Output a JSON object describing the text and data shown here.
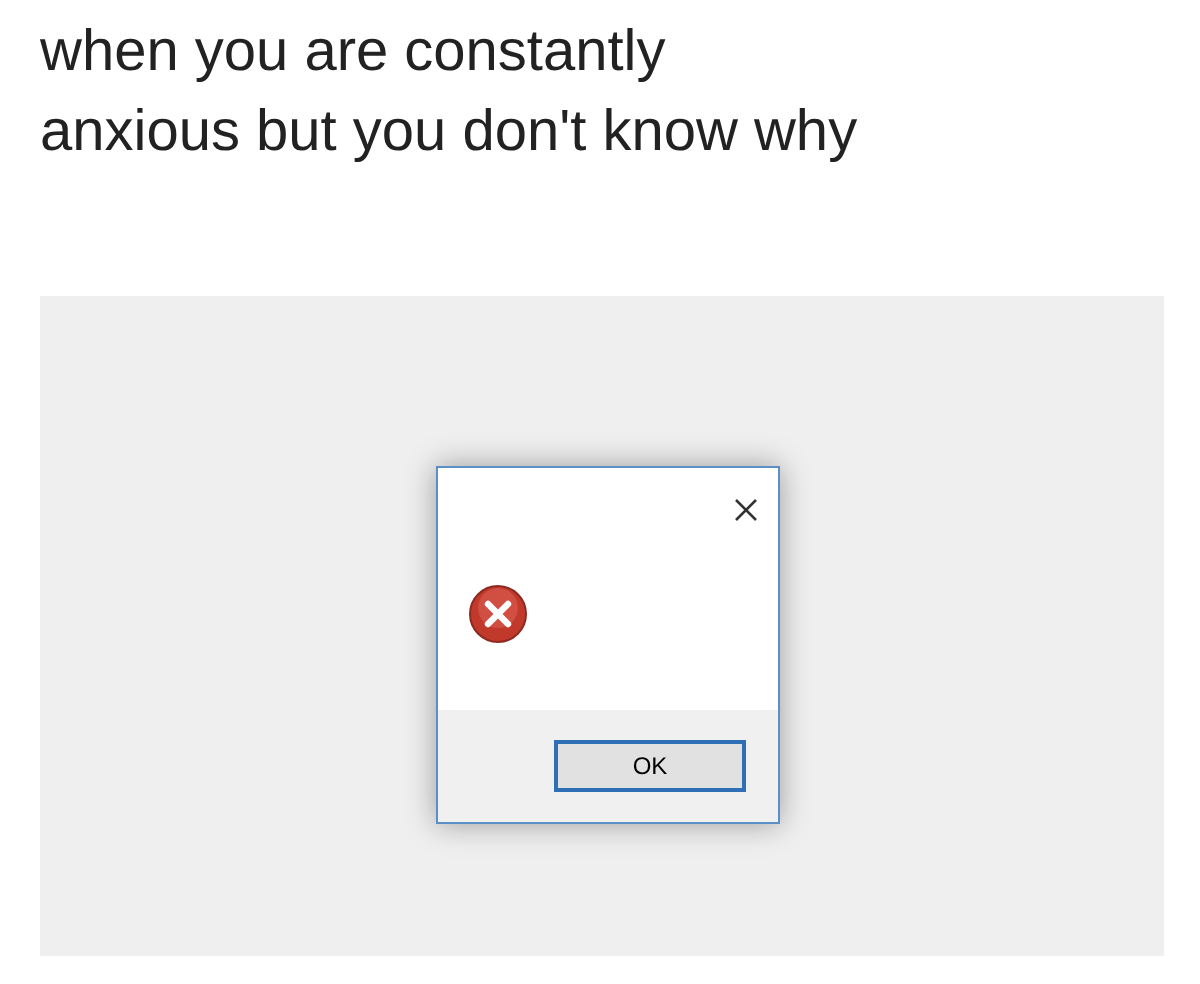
{
  "caption_lines": [
    "when you are constantly",
    "anxious but you don't know why"
  ],
  "dialog": {
    "button": "OK",
    "button_focused": true
  }
}
